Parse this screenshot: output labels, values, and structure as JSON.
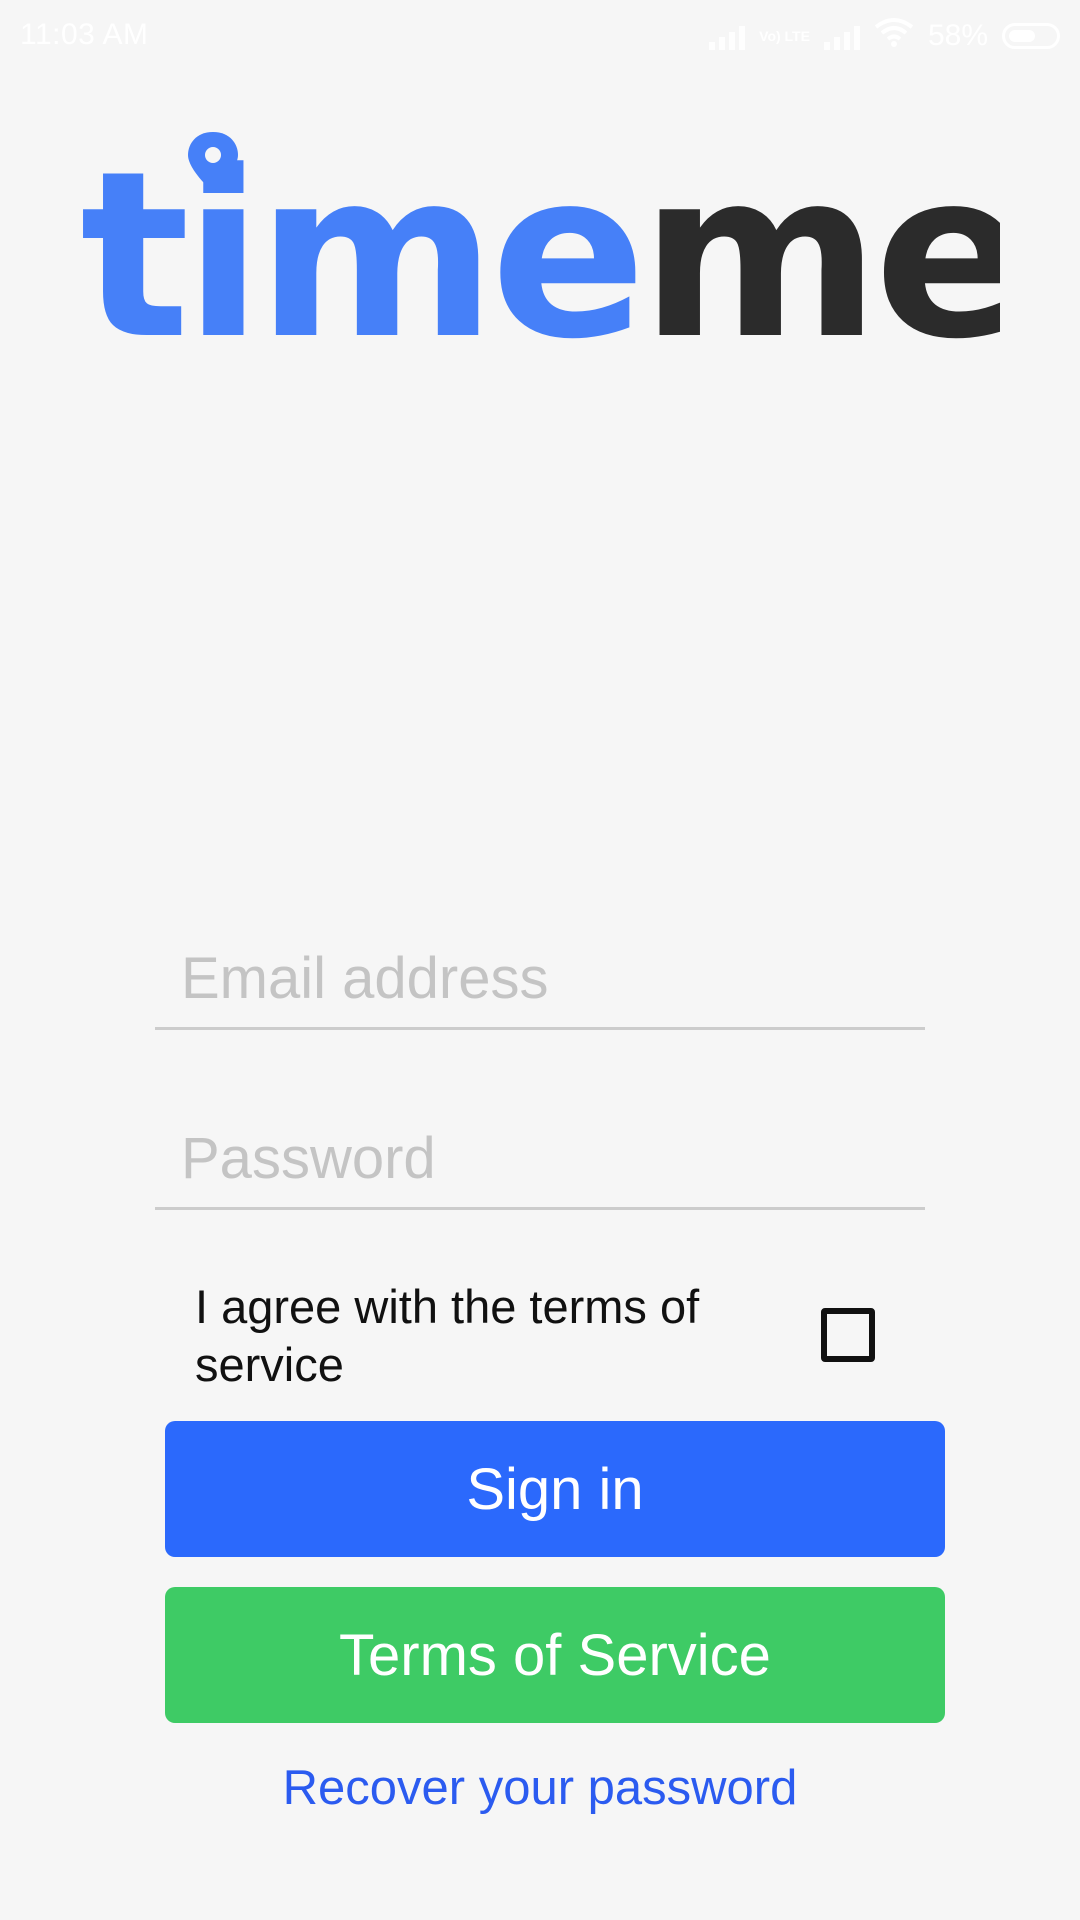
{
  "status_bar": {
    "time": "11:03 AM",
    "network_label": "Vo) LTE",
    "battery": "58%",
    "battery_level": 0.58
  },
  "logo": {
    "part_blue": "time",
    "part_dark": "me",
    "blue_color": "#4680f8",
    "dark_color": "#2b2b2b",
    "pin_icon": "location-pin-icon"
  },
  "form": {
    "email_placeholder": "Email address",
    "email_value": "",
    "password_placeholder": "Password",
    "password_value": "",
    "agree_label": "I agree with the terms of service",
    "agree_checked": false
  },
  "buttons": {
    "sign_in": "Sign in",
    "terms": "Terms of Service",
    "sign_in_color": "#2b69fc",
    "terms_color": "#3ecb65"
  },
  "links": {
    "recover": "Recover your password",
    "recover_color": "#2b5bf0"
  }
}
